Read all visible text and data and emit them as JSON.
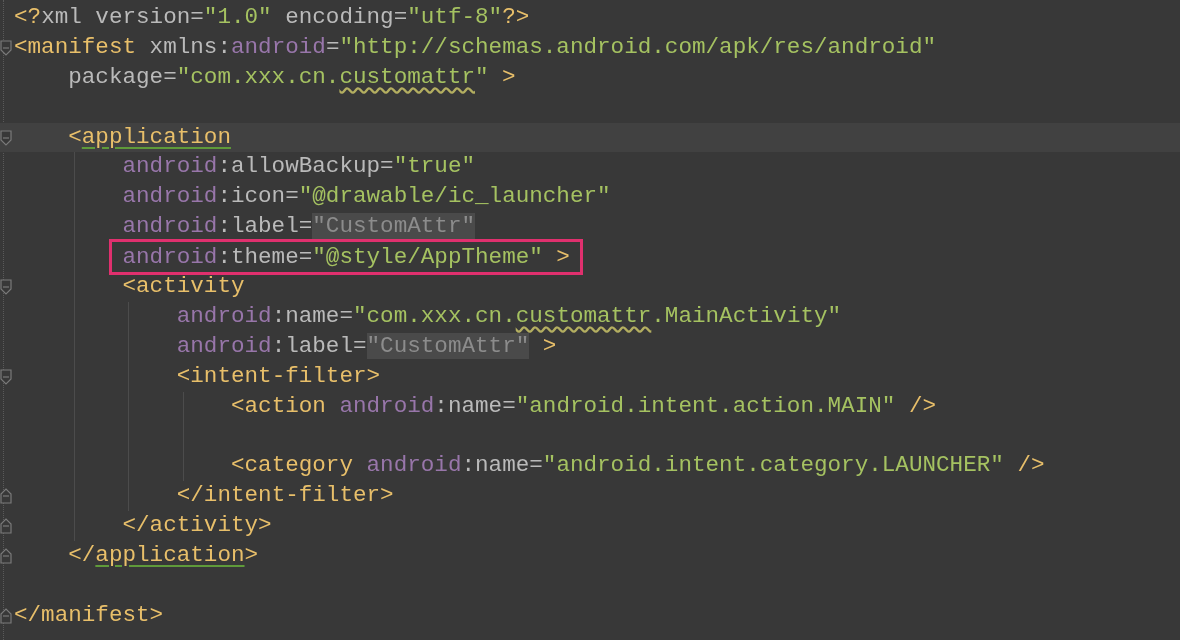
{
  "lines": [
    {
      "kind": "code",
      "tokens": [
        {
          "t": "<?",
          "kind": "tag"
        },
        {
          "t": "xml version=",
          "kind": "attr"
        },
        {
          "t": "\"1.0\"",
          "kind": "value"
        },
        {
          "t": " encoding=",
          "kind": "attr"
        },
        {
          "t": "\"utf-8\"",
          "kind": "value"
        },
        {
          "t": "?>",
          "kind": "tag"
        }
      ]
    },
    {
      "fold_open": true,
      "tokens": [
        {
          "t": "<manifest ",
          "kind": "tag"
        },
        {
          "t": "xmlns:",
          "kind": "attr"
        },
        {
          "t": "android",
          "kind": "ns"
        },
        {
          "t": "=",
          "kind": "attr"
        },
        {
          "t": "\"http://schemas.android.com/apk/res/android\"",
          "kind": "value"
        }
      ]
    },
    {
      "tokens": [
        {
          "t": "    package=",
          "kind": "attr"
        },
        {
          "t": "\"com.xxx.cn.",
          "kind": "value"
        },
        {
          "t": "customattr",
          "kind": "value",
          "warning": true
        },
        {
          "t": "\"",
          "kind": "value"
        },
        {
          "t": " >",
          "kind": "tag"
        }
      ]
    },
    {
      "kind": "blank"
    },
    {
      "fold_open": true,
      "current": true,
      "tokens": [
        {
          "t": "    <",
          "kind": "tag"
        },
        {
          "t": "application",
          "kind": "tag",
          "matched": true
        }
      ]
    },
    {
      "tokens": [
        {
          "t": "        android",
          "kind": "ns"
        },
        {
          "t": ":allowBackup=",
          "kind": "attr"
        },
        {
          "t": "\"true\"",
          "kind": "value"
        }
      ]
    },
    {
      "tokens": [
        {
          "t": "        android",
          "kind": "ns"
        },
        {
          "t": ":icon=",
          "kind": "attr"
        },
        {
          "t": "\"@drawable/ic_launcher\"",
          "kind": "value"
        }
      ]
    },
    {
      "tokens": [
        {
          "t": "        android",
          "kind": "ns"
        },
        {
          "t": ":label=",
          "kind": "attr"
        },
        {
          "t": "\"CustomAttr\"",
          "kind": "dim"
        }
      ]
    },
    {
      "boxed": true,
      "tokens": [
        {
          "t": "        android",
          "kind": "ns"
        },
        {
          "t": ":theme=",
          "kind": "attr"
        },
        {
          "t": "\"@style/AppTheme\"",
          "kind": "value"
        },
        {
          "t": " >",
          "kind": "tag"
        }
      ]
    },
    {
      "fold_open": true,
      "tokens": [
        {
          "t": "        <activity",
          "kind": "tag"
        }
      ]
    },
    {
      "tokens": [
        {
          "t": "            android",
          "kind": "ns"
        },
        {
          "t": ":name=",
          "kind": "attr"
        },
        {
          "t": "\"com.xxx.cn.",
          "kind": "value"
        },
        {
          "t": "customattr",
          "kind": "value",
          "warning": true
        },
        {
          "t": ".MainActivity\"",
          "kind": "value"
        }
      ]
    },
    {
      "tokens": [
        {
          "t": "            android",
          "kind": "ns"
        },
        {
          "t": ":label=",
          "kind": "attr"
        },
        {
          "t": "\"CustomAttr\"",
          "kind": "dim"
        },
        {
          "t": " >",
          "kind": "tag"
        }
      ]
    },
    {
      "fold_open": true,
      "tokens": [
        {
          "t": "            <intent-filter>",
          "kind": "tag"
        }
      ]
    },
    {
      "tokens": [
        {
          "t": "                <action ",
          "kind": "tag"
        },
        {
          "t": "android",
          "kind": "ns"
        },
        {
          "t": ":name=",
          "kind": "attr"
        },
        {
          "t": "\"android.intent.action.MAIN\"",
          "kind": "value"
        },
        {
          "t": " />",
          "kind": "tag"
        }
      ]
    },
    {
      "kind": "blank"
    },
    {
      "tokens": [
        {
          "t": "                <category ",
          "kind": "tag"
        },
        {
          "t": "android",
          "kind": "ns"
        },
        {
          "t": ":name=",
          "kind": "attr"
        },
        {
          "t": "\"android.intent.category.LAUNCHER\"",
          "kind": "value"
        },
        {
          "t": " />",
          "kind": "tag"
        }
      ]
    },
    {
      "fold_close": true,
      "tokens": [
        {
          "t": "            </intent-filter>",
          "kind": "tag"
        }
      ]
    },
    {
      "fold_close": true,
      "tokens": [
        {
          "t": "        </activity>",
          "kind": "tag"
        }
      ]
    },
    {
      "fold_close": true,
      "tokens": [
        {
          "t": "    </",
          "kind": "tag"
        },
        {
          "t": "application",
          "kind": "tag",
          "matched": true
        },
        {
          "t": ">",
          "kind": "tag"
        }
      ]
    },
    {
      "kind": "blank"
    },
    {
      "fold_close": true,
      "tokens": [
        {
          "t": "</manifest>",
          "kind": "tag"
        }
      ]
    }
  ]
}
